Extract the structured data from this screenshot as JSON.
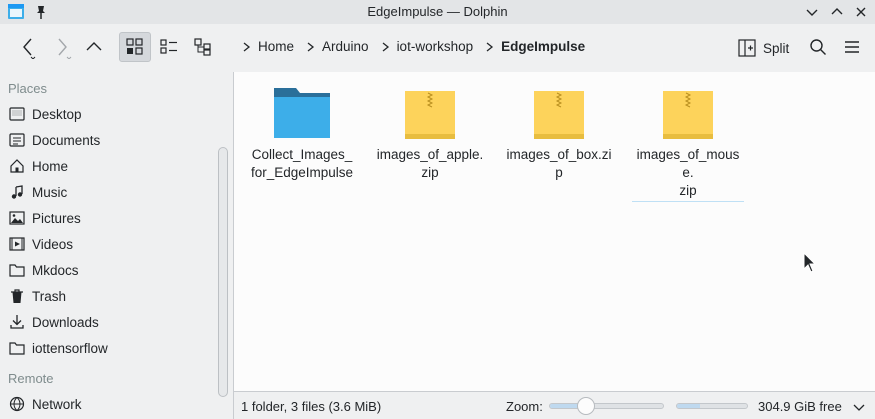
{
  "window": {
    "title": "EdgeImpulse — Dolphin"
  },
  "toolbar": {
    "breadcrumbs": [
      "Home",
      "Arduino",
      "iot-workshop",
      "EdgeImpulse"
    ],
    "split_label": "Split"
  },
  "sidebar": {
    "places_title": "Places",
    "places": [
      {
        "label": "Desktop",
        "icon": "desktop-icon"
      },
      {
        "label": "Documents",
        "icon": "documents-icon"
      },
      {
        "label": "Home",
        "icon": "home-icon"
      },
      {
        "label": "Music",
        "icon": "music-icon"
      },
      {
        "label": "Pictures",
        "icon": "pictures-icon"
      },
      {
        "label": "Videos",
        "icon": "videos-icon"
      },
      {
        "label": "Mkdocs",
        "icon": "folder-icon"
      },
      {
        "label": "Trash",
        "icon": "trash-icon"
      },
      {
        "label": "Downloads",
        "icon": "downloads-icon"
      },
      {
        "label": "iottensorflow",
        "icon": "folder-icon"
      }
    ],
    "remote_title": "Remote",
    "remote": [
      {
        "label": "Network",
        "icon": "network-icon"
      }
    ]
  },
  "files": [
    {
      "name": "Collect_Images_\nfor_EdgeImpulse",
      "type": "folder",
      "icon": "folder-icon"
    },
    {
      "name": "images_of_apple.\nzip",
      "type": "zip",
      "icon": "zip-archive-icon"
    },
    {
      "name": "images_of_box.zip",
      "type": "zip",
      "icon": "zip-archive-icon"
    },
    {
      "name": "images_of_mouse.\nzip",
      "type": "zip",
      "icon": "zip-archive-icon"
    }
  ],
  "statusbar": {
    "summary": "1 folder, 3 files (3.6 MiB)",
    "zoom_label": "Zoom:",
    "zoom_level": 0.28,
    "disk_used_fraction": 0.33,
    "free_space": "304.9 GiB free"
  },
  "colors": {
    "folder_blue": "#3daee9",
    "folder_tab": "#2a6f9a",
    "zip_yellow": "#fdd35b",
    "selection": "#bfd9ef"
  }
}
